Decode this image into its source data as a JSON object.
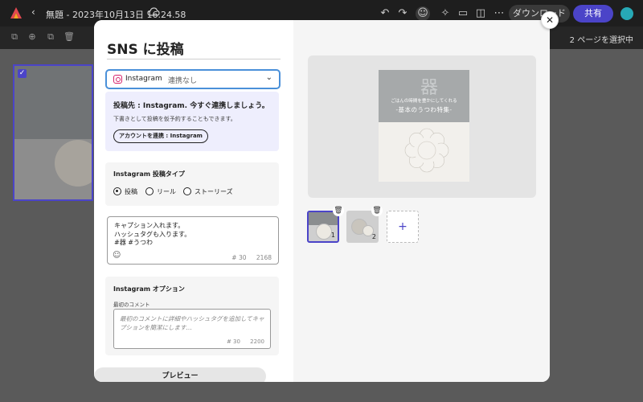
{
  "topbar": {
    "title": "無題 - 2023年10月13日 16.24.58",
    "download_label": "ダウンロード",
    "share_label": "共有"
  },
  "toolbar2": {
    "selection_text": "2 ページを選択中"
  },
  "modal": {
    "title": "SNS に投稿",
    "account": {
      "platform": "Instagram",
      "status": "連携なし"
    },
    "connect": {
      "heading": "投稿先 : Instagram. 今すぐ連携しましょう。",
      "description": "下書きとして投稿を仮予約することもできます。",
      "button_label": "アカウントを連携 : Instagram"
    },
    "post_type": {
      "label": "Instagram 投稿タイプ",
      "options": [
        {
          "label": "投稿",
          "selected": true
        },
        {
          "label": "リール",
          "selected": false
        },
        {
          "label": "ストーリーズ",
          "selected": false
        }
      ]
    },
    "caption": {
      "text": "キャプション入れます。\nハッシュタグも入ります。\n#器 #うつわ",
      "hashtag_count": "# 30",
      "char_count": "2168"
    },
    "options": {
      "label": "Instagram オプション",
      "first_comment_label": "最初のコメント",
      "first_comment_placeholder": "最初のコメントに詳細やハッシュタグを追加してキャプションを簡潔にします…",
      "hashtag_count": "# 30",
      "char_count": "2200"
    },
    "preview_label": "プレビュー",
    "preview": {
      "kanji": "器",
      "line1": "ごはんの時間を豊かにしてくれる",
      "line2": "-基本のうつわ特集-"
    },
    "pages": [
      {
        "number": "1",
        "selected": true
      },
      {
        "number": "2",
        "selected": false
      }
    ],
    "add_page": "+"
  },
  "colors": {
    "accent": "#4b44c8",
    "focus": "#4a90d9",
    "instagram": "#d6236c"
  }
}
